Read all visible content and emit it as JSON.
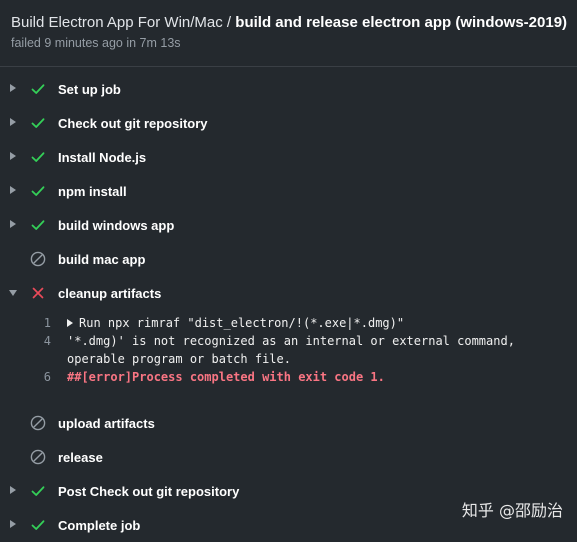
{
  "header": {
    "workflow": "Build Electron App For Win/Mac",
    "separator": " / ",
    "job": "build and release electron app (windows-2019)",
    "status_line": "failed 9 minutes ago in 7m 13s"
  },
  "steps": [
    {
      "label": "Set up job",
      "status": "success",
      "icon": "check-icon",
      "expand": "collapsed"
    },
    {
      "label": "Check out git repository",
      "status": "success",
      "icon": "check-icon",
      "expand": "collapsed"
    },
    {
      "label": "Install Node.js",
      "status": "success",
      "icon": "check-icon",
      "expand": "collapsed"
    },
    {
      "label": "npm install",
      "status": "success",
      "icon": "check-icon",
      "expand": "collapsed"
    },
    {
      "label": "build windows app",
      "status": "success",
      "icon": "check-icon",
      "expand": "collapsed"
    },
    {
      "label": "build mac app",
      "status": "skipped",
      "icon": "skipped-icon",
      "expand": "none"
    },
    {
      "label": "cleanup artifacts",
      "status": "failure",
      "icon": "x-icon",
      "expand": "expanded"
    },
    {
      "label": "upload artifacts",
      "status": "skipped",
      "icon": "skipped-icon",
      "expand": "none"
    },
    {
      "label": "release",
      "status": "skipped",
      "icon": "skipped-icon",
      "expand": "none"
    },
    {
      "label": "Post Check out git repository",
      "status": "success",
      "icon": "check-icon",
      "expand": "collapsed"
    },
    {
      "label": "Complete job",
      "status": "success",
      "icon": "check-icon",
      "expand": "collapsed"
    }
  ],
  "log": [
    {
      "num": "1",
      "text": "Run npx rimraf \"dist_electron/!(*.exe|*.dmg)\"",
      "type": "command"
    },
    {
      "num": "4",
      "text": "'*.dmg)' is not recognized as an internal or external command,",
      "type": "output"
    },
    {
      "num": "",
      "text": "operable program or batch file.",
      "type": "output"
    },
    {
      "num": "6",
      "text": "##[error]Process completed with exit code 1.",
      "type": "error"
    }
  ],
  "watermark": "知乎 @邵励治",
  "colors": {
    "background": "#24292e",
    "success": "#34d058",
    "failure": "#ea4a5a",
    "muted": "#959da5",
    "error_text": "#f97583"
  }
}
